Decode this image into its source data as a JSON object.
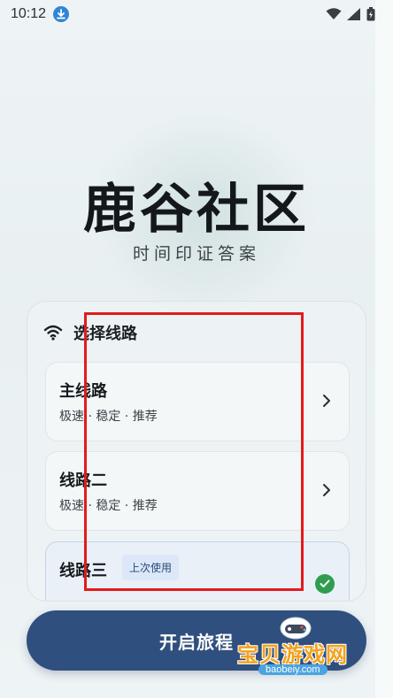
{
  "status_bar": {
    "time": "10:12"
  },
  "hero": {
    "title": "鹿谷社区",
    "slogan": "时间印证答案"
  },
  "route_panel": {
    "title": "选择线路",
    "routes": [
      {
        "name": "主线路",
        "desc": "极速 · 稳定 · 推荐"
      },
      {
        "name": "线路二",
        "desc": "极速 · 稳定 · 推荐"
      },
      {
        "name": "线路三",
        "badge": "上次使用",
        "selected": true
      }
    ]
  },
  "start_button": {
    "label": "开启旅程"
  },
  "watermark": {
    "text": "宝贝游戏网",
    "url": "baobeiy.com"
  },
  "colors": {
    "accent": "#2f4f7e",
    "check": "#2e9d4f",
    "annotation": "#e21b1b"
  }
}
